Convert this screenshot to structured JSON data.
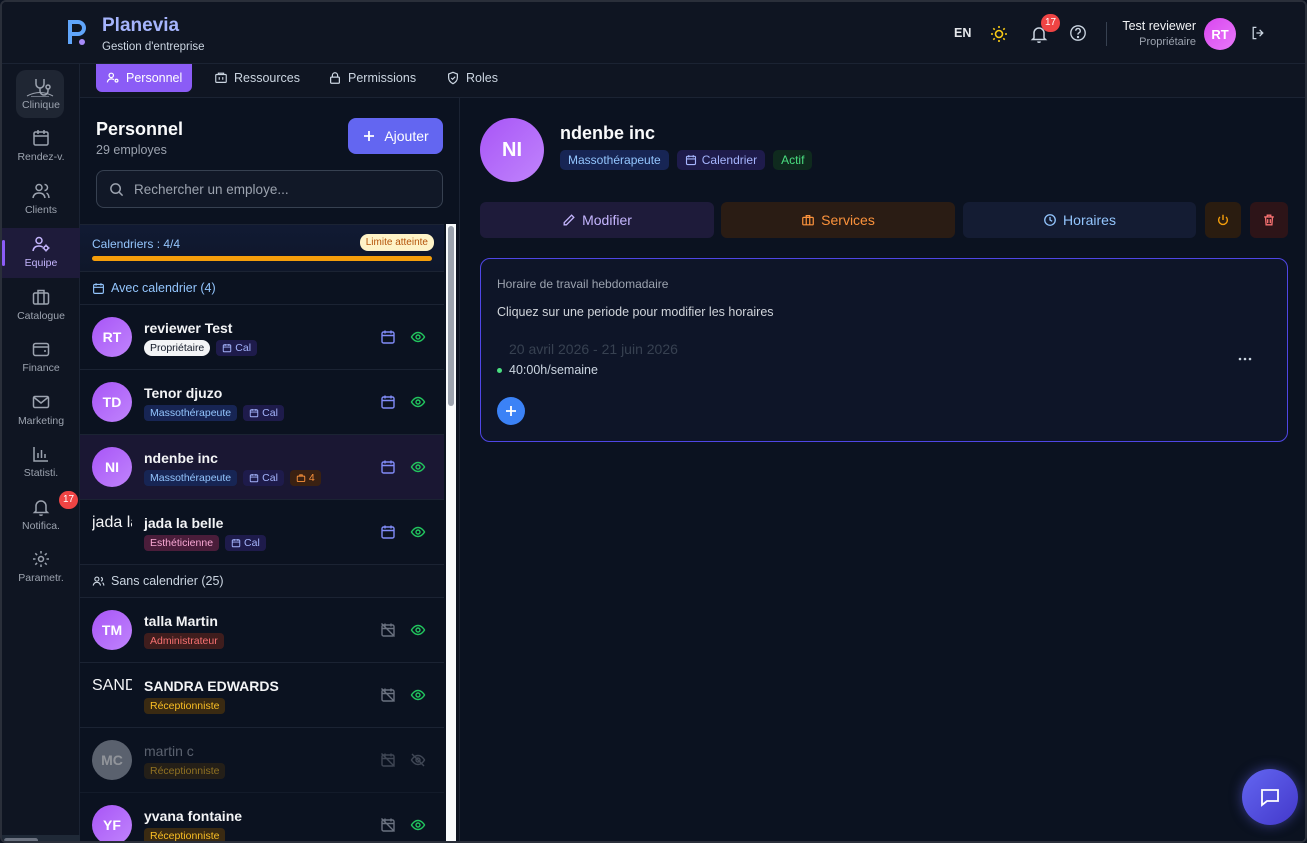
{
  "brand": {
    "name": "Planevia",
    "subtitle": "Gestion d'entreprise"
  },
  "topbar": {
    "language": "EN",
    "notifications_count": "17",
    "user": {
      "name": "Test reviewer",
      "role": "Propriétaire",
      "initials": "RT"
    }
  },
  "nav": {
    "items": [
      {
        "label": "Clinique",
        "icon": "stethoscope-icon"
      },
      {
        "label": "Rendez-v.",
        "icon": "calendar-icon"
      },
      {
        "label": "Clients",
        "icon": "users-icon"
      },
      {
        "label": "Equipe",
        "icon": "team-settings-icon",
        "active": true
      },
      {
        "label": "Catalogue",
        "icon": "briefcase-icon"
      },
      {
        "label": "Finance",
        "icon": "wallet-icon"
      },
      {
        "label": "Marketing",
        "icon": "mail-icon"
      },
      {
        "label": "Statisti.",
        "icon": "bar-chart-icon"
      },
      {
        "label": "Notifica.",
        "icon": "bell-icon",
        "badge": "17"
      },
      {
        "label": "Parametr.",
        "icon": "gear-icon"
      }
    ]
  },
  "tabs": [
    {
      "label": "Personnel",
      "active": true
    },
    {
      "label": "Ressources"
    },
    {
      "label": "Permissions"
    },
    {
      "label": "Roles"
    }
  ],
  "staff_panel": {
    "title": "Personnel",
    "count_text": "29 employes",
    "add_label": "Ajouter",
    "search_placeholder": "Rechercher un employe...",
    "calendars_text": "Calendriers : 4/4",
    "limit_badge": "Limite atteinte",
    "calendar_fill": 1.0,
    "group_with": "Avec calendrier (4)",
    "group_without": "Sans calendrier (25)",
    "with_calendar": [
      {
        "initials": "RT",
        "name": "reviewer Test",
        "role": "Propriétaire",
        "role_kind": "owner",
        "cal": "Cal"
      },
      {
        "initials": "TD",
        "name": "Tenor djuzo",
        "role": "Massothérapeute",
        "role_kind": "masso",
        "cal": "Cal"
      },
      {
        "initials": "NI",
        "name": "ndenbe inc",
        "role": "Massothérapeute",
        "role_kind": "masso",
        "cal": "Cal",
        "services": "4",
        "selected": true
      },
      {
        "initials": "jada la belle",
        "name": "jada la belle",
        "role": "Esthéticienne",
        "role_kind": "esth",
        "cal": "Cal",
        "image": true
      }
    ],
    "without_calendar": [
      {
        "initials": "TM",
        "name": "talla Martin",
        "role": "Administrateur",
        "role_kind": "admin"
      },
      {
        "initials": "SANDRA EDWARDS",
        "name": "SANDRA EDWARDS",
        "role": "Réceptionniste",
        "role_kind": "recep",
        "image": true
      },
      {
        "initials": "MC",
        "name": "martin c",
        "role": "Réceptionniste",
        "role_kind": "recep",
        "dim": true
      },
      {
        "initials": "YF",
        "name": "yvana fontaine",
        "role": "Réceptionniste",
        "role_kind": "recep"
      }
    ]
  },
  "detail": {
    "initials": "NI",
    "name": "ndenbe inc",
    "role": "Massothérapeute",
    "calendar": "Calendrier",
    "status": "Actif",
    "buttons": {
      "edit": "Modifier",
      "services": "Services",
      "hours": "Horaires"
    },
    "hours_card": {
      "title": "Horaire de travail hebdomadaire",
      "hint": "Cliquez sur une periode pour modifier les horaires",
      "period": "20 avril 2026 - 21 juin 2026",
      "hours": "40:00h/semaine"
    }
  },
  "colors": {
    "accent": "#8b5cf6",
    "primary_button": "#6366f1",
    "warning": "#f59e0b",
    "success": "#4ade80",
    "danger": "#ef4444"
  }
}
